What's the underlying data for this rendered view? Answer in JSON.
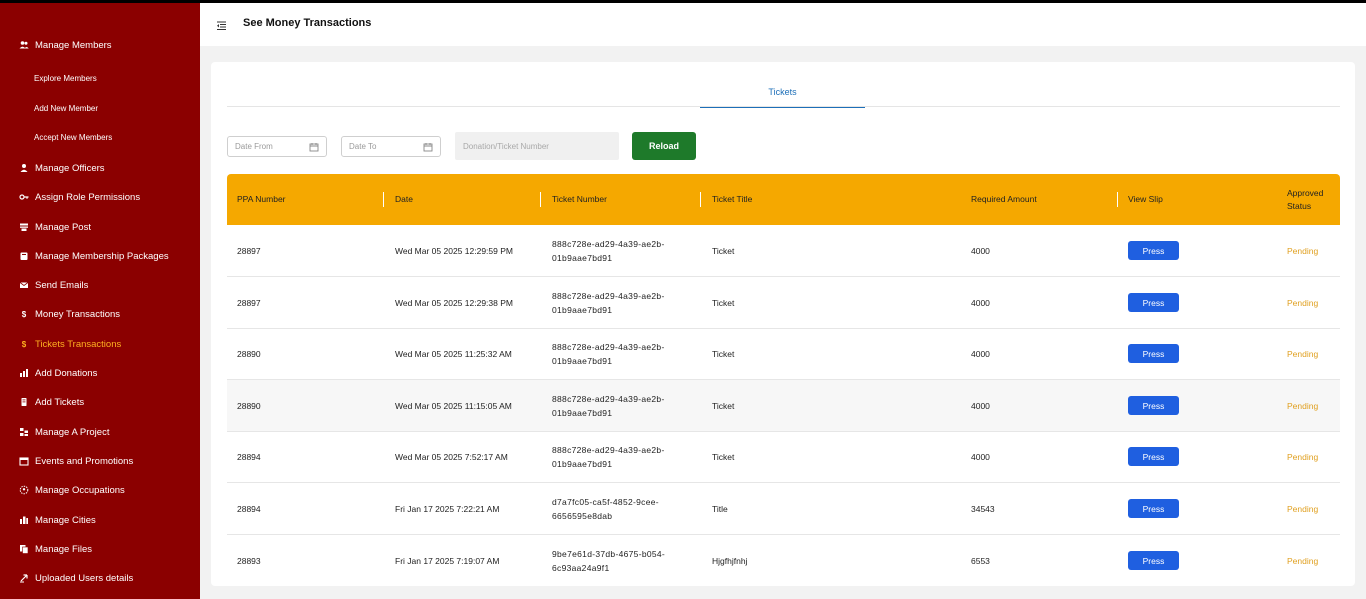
{
  "header": {
    "title": "See Money Transactions"
  },
  "sidebar": {
    "items": [
      {
        "label": "Manage Members",
        "icon": "users-icon",
        "sub": false,
        "active": false
      },
      {
        "label": "Explore Members",
        "sub": true
      },
      {
        "label": "Add New Member",
        "sub": true
      },
      {
        "label": "Accept New Members",
        "sub": true
      },
      {
        "label": "Manage Officers",
        "icon": "user-icon",
        "sub": false
      },
      {
        "label": "Assign Role Permissions",
        "icon": "key-icon",
        "sub": false
      },
      {
        "label": "Manage Post",
        "icon": "post-icon",
        "sub": false
      },
      {
        "label": "Manage Membership Packages",
        "icon": "package-icon",
        "sub": false
      },
      {
        "label": "Send Emails",
        "icon": "mail-icon",
        "sub": false
      },
      {
        "label": "Money Transactions",
        "icon": "dollar-icon",
        "sub": false
      },
      {
        "label": "Tickets Transactions",
        "icon": "dollar-icon",
        "sub": false,
        "active": true
      },
      {
        "label": "Add Donations",
        "icon": "chart-icon",
        "sub": false
      },
      {
        "label": "Add Tickets",
        "icon": "ticket-icon",
        "sub": false
      },
      {
        "label": "Manage A Project",
        "icon": "project-icon",
        "sub": false
      },
      {
        "label": "Events and Promotions",
        "icon": "calendar-icon",
        "sub": false
      },
      {
        "label": "Manage Occupations",
        "icon": "occupation-icon",
        "sub": false
      },
      {
        "label": "Manage Cities",
        "icon": "city-icon",
        "sub": false
      },
      {
        "label": "Manage Files",
        "icon": "files-icon",
        "sub": false
      },
      {
        "label": "Uploaded Users details",
        "icon": "upload-icon",
        "sub": false
      }
    ]
  },
  "tabs": [
    {
      "label": "Tickets",
      "active": true
    }
  ],
  "filters": {
    "date_from": "Date From",
    "date_to": "Date To",
    "search_placeholder": "Donation/Ticket Number",
    "reload_label": "Reload"
  },
  "table": {
    "columns": [
      "PPA Number",
      "Date",
      "Ticket Number",
      "Ticket Title",
      "Required Amount",
      "View Slip",
      "Approved Status"
    ],
    "rows": [
      {
        "ppa": "28897",
        "date": "Wed Mar 05 2025 12:29:59 PM",
        "ticket_line1": "888c728e-ad29-4a39-ae2b-",
        "ticket_line2": "01b9aae7bd91",
        "title": "Ticket",
        "amount": "4000",
        "slip": "Press",
        "status": "Pending"
      },
      {
        "ppa": "28897",
        "date": "Wed Mar 05 2025 12:29:38 PM",
        "ticket_line1": "888c728e-ad29-4a39-ae2b-",
        "ticket_line2": "01b9aae7bd91",
        "title": "Ticket",
        "amount": "4000",
        "slip": "Press",
        "status": "Pending"
      },
      {
        "ppa": "28890",
        "date": "Wed Mar 05 2025 11:25:32 AM",
        "ticket_line1": "888c728e-ad29-4a39-ae2b-",
        "ticket_line2": "01b9aae7bd91",
        "title": "Ticket",
        "amount": "4000",
        "slip": "Press",
        "status": "Pending"
      },
      {
        "ppa": "28890",
        "date": "Wed Mar 05 2025 11:15:05 AM",
        "ticket_line1": "888c728e-ad29-4a39-ae2b-",
        "ticket_line2": "01b9aae7bd91",
        "title": "Ticket",
        "amount": "4000",
        "slip": "Press",
        "status": "Pending"
      },
      {
        "ppa": "28894",
        "date": "Wed Mar 05 2025 7:52:17 AM",
        "ticket_line1": "888c728e-ad29-4a39-ae2b-",
        "ticket_line2": "01b9aae7bd91",
        "title": "Ticket",
        "amount": "4000",
        "slip": "Press",
        "status": "Pending"
      },
      {
        "ppa": "28894",
        "date": "Fri Jan 17 2025 7:22:21 AM",
        "ticket_line1": "d7a7fc05-ca5f-4852-9cee-",
        "ticket_line2": "6656595e8dab",
        "title": "Title",
        "amount": "34543",
        "slip": "Press",
        "status": "Pending"
      },
      {
        "ppa": "28893",
        "date": "Fri Jan 17 2025 7:19:07 AM",
        "ticket_line1": "9be7e61d-37db-4675-b054-",
        "ticket_line2": "6c93aa24a9f1",
        "title": "Hjgfhjfnhj",
        "amount": "6553",
        "slip": "Press",
        "status": "Pending"
      }
    ]
  },
  "colors": {
    "sidebar": "#8b0000",
    "active": "#ffb020",
    "header_row": "#f5a800",
    "reload": "#1e7a2a",
    "press": "#1f5fe0",
    "pending": "#e0a020",
    "tab": "#1d6fb8"
  }
}
